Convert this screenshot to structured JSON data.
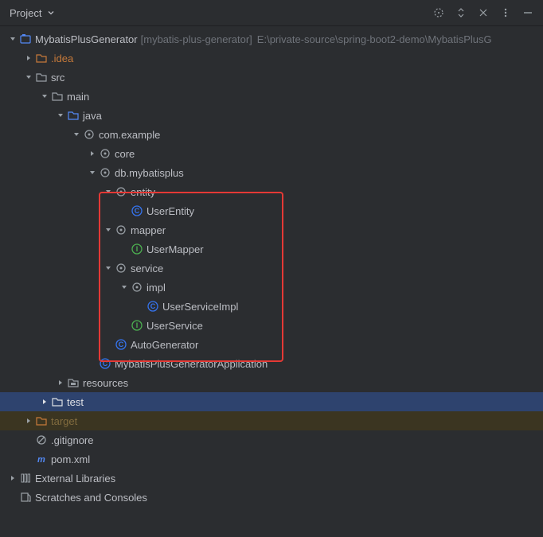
{
  "header": {
    "title": "Project"
  },
  "root": {
    "name": "MybatisPlusGenerator",
    "vcs": "[mybatis-plus-generator]",
    "path": "E:\\private-source\\spring-boot2-demo\\MybatisPlusG"
  },
  "nodes": {
    "idea": ".idea",
    "src": "src",
    "main": "main",
    "java": "java",
    "pkg": "com.example",
    "core": "core",
    "db": "db.mybatisplus",
    "entity": "entity",
    "userEntity": "UserEntity",
    "mapper": "mapper",
    "userMapper": "UserMapper",
    "service": "service",
    "impl": "impl",
    "userServiceImpl": "UserServiceImpl",
    "userService": "UserService",
    "autoGenerator": "AutoGenerator",
    "app": "MybatisPlusGeneratorApplication",
    "resources": "resources",
    "test": "test",
    "target": "target",
    "gitignore": ".gitignore",
    "pom": "pom.xml",
    "external": "External Libraries",
    "scratches": "Scratches and Consoles"
  }
}
